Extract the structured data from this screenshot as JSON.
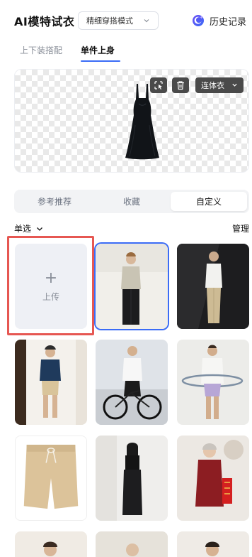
{
  "header": {
    "title": "AI模特试衣",
    "mode_select": "精细穿搭模式",
    "history_label": "历史记录"
  },
  "tabs": [
    {
      "label": "上下装搭配",
      "active": false
    },
    {
      "label": "单件上身",
      "active": true
    }
  ],
  "preview": {
    "garment_type": "连体衣",
    "tools": [
      "select-icon",
      "trash-icon"
    ]
  },
  "segments": [
    {
      "label": "参考推荐",
      "active": false
    },
    {
      "label": "收藏",
      "active": false
    },
    {
      "label": "自定义",
      "active": true
    }
  ],
  "filter": {
    "label": "单选"
  },
  "manage_label": "管理",
  "upload": {
    "plus": "+",
    "label": "上传"
  },
  "colors": {
    "accent": "#3b6cf6",
    "highlight": "#e65752",
    "upload_bg": "#eef0f5"
  },
  "models": [
    {
      "name": "model-beige-tee-black-pants",
      "selected": true
    },
    {
      "name": "model-white-shirt-khaki-pants",
      "selected": false
    },
    {
      "name": "model-navy-tee-khaki-shorts",
      "selected": false
    },
    {
      "name": "model-cyclist-white-jacket",
      "selected": false
    },
    {
      "name": "model-white-sweater-hula-hoop",
      "selected": false
    },
    {
      "name": "model-khaki-shorts-product",
      "selected": false
    },
    {
      "name": "model-black-outfit-woman",
      "selected": false
    },
    {
      "name": "model-elder-red-jacket",
      "selected": false
    }
  ]
}
